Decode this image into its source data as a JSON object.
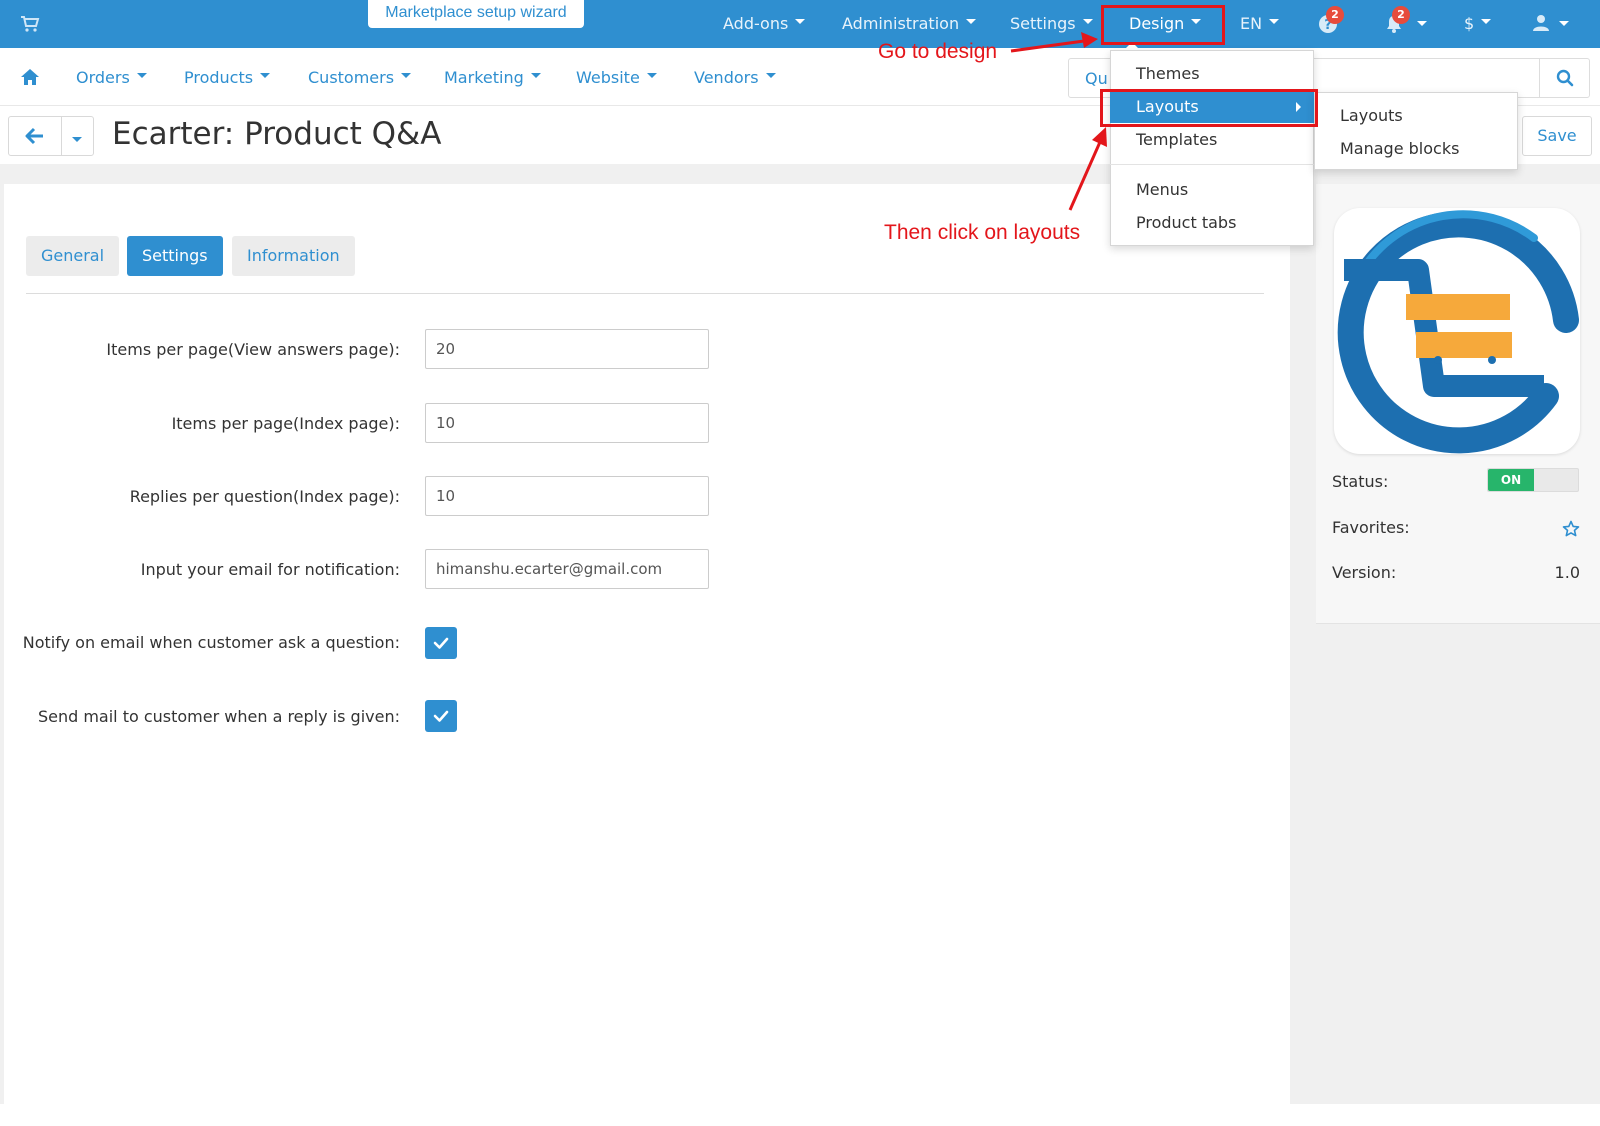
{
  "topbar": {
    "wizard_label": "Marketplace setup wizard",
    "items": [
      "Add-ons",
      "Administration",
      "Settings",
      "Design",
      "EN",
      "$"
    ],
    "help_badge": "2",
    "notification_badge": "2"
  },
  "mainnav": {
    "items": [
      "Orders",
      "Products",
      "Customers",
      "Marketing",
      "Website",
      "Vendors"
    ],
    "search_placeholder": "Qu"
  },
  "titlebar": {
    "title": "Ecarter: Product Q&A",
    "save_label": "Save"
  },
  "tabs": [
    "General",
    "Settings",
    "Information"
  ],
  "form": {
    "fields": [
      {
        "label": "Items per page(View answers page):",
        "value": "20"
      },
      {
        "label": "Items per page(Index page):",
        "value": "10"
      },
      {
        "label": "Replies per question(Index page):",
        "value": "10"
      },
      {
        "label": "Input your email for notification:",
        "value": "himanshu.ecarter@gmail.com"
      }
    ],
    "checkboxes": [
      {
        "label": "Notify on email when customer ask a question:",
        "checked": true
      },
      {
        "label": "Send mail to customer when a reply is given:",
        "checked": true
      }
    ]
  },
  "side": {
    "status_label": "Status:",
    "status_value": "ON",
    "favorites_label": "Favorites:",
    "version_label": "Version:",
    "version_value": "1.0"
  },
  "dropdown": {
    "items": [
      "Themes",
      "Layouts",
      "Templates",
      "Menus",
      "Product tabs"
    ],
    "submenu": [
      "Layouts",
      "Manage blocks"
    ]
  },
  "annotations": {
    "go_to_design": "Go to design",
    "click_layouts": "Then click on layouts"
  },
  "colors": {
    "primary": "#2f8fd0",
    "annotation": "#e3161b",
    "toggle_on": "#27b56b",
    "logo_orange": "#f6a93b"
  }
}
